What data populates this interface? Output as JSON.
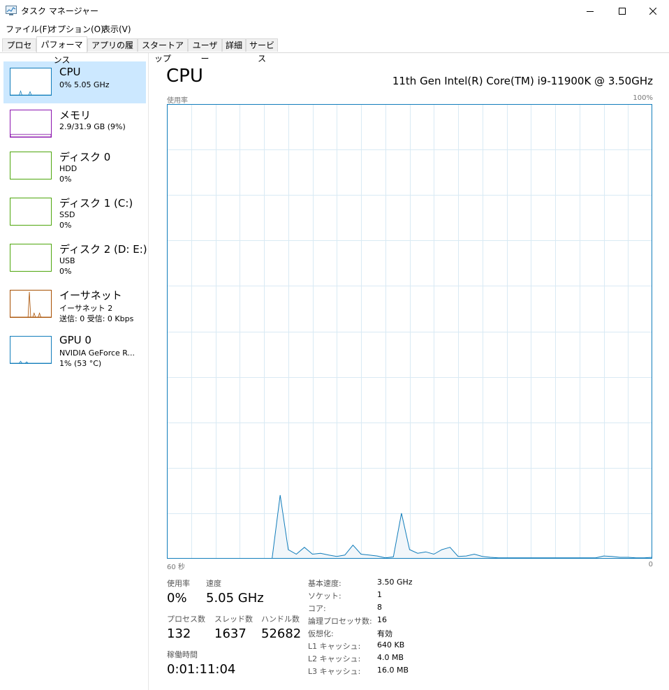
{
  "window": {
    "title": "タスク マネージャー"
  },
  "menu": [
    "ファイル(F)",
    "オプション(O)",
    "表示(V)"
  ],
  "tabs": [
    "プロセス",
    "パフォーマンス",
    "アプリの履歴",
    "スタートアップ",
    "ユーザー",
    "詳細",
    "サービス"
  ],
  "active_tab": "パフォーマンス",
  "sidebar": {
    "items": [
      {
        "title": "CPU",
        "line1": "0%  5.05 GHz",
        "line2": "",
        "color": "#117dbb"
      },
      {
        "title": "メモリ",
        "line1": "2.9/31.9 GB (9%)",
        "line2": "",
        "color": "#8b12ae"
      },
      {
        "title": "ディスク 0",
        "line1": "HDD",
        "line2": "0%",
        "color": "#4da60c"
      },
      {
        "title": "ディスク 1 (C:)",
        "line1": "SSD",
        "line2": "0%",
        "color": "#4da60c"
      },
      {
        "title": "ディスク 2 (D: E:)",
        "line1": "USB",
        "line2": "0%",
        "color": "#4da60c"
      },
      {
        "title": "イーサネット",
        "line1": "イーサネット 2",
        "line2": "送信: 0 受信: 0 Kbps",
        "color": "#a74f01"
      },
      {
        "title": "GPU 0",
        "line1": "NVIDIA GeForce R...",
        "line2": "1% (53 °C)",
        "color": "#117dbb"
      }
    ]
  },
  "main": {
    "title": "CPU",
    "processor": "11th Gen Intel(R) Core(TM) i9-11900K @ 3.50GHz",
    "graph_label_left": "使用率",
    "graph_label_right": "100%",
    "axis_left": "60 秒",
    "axis_right": "0"
  },
  "chart_data": {
    "type": "area",
    "x": [
      60,
      59,
      58,
      57,
      56,
      55,
      54,
      53,
      52,
      51,
      50,
      49,
      48,
      47,
      46,
      45,
      44,
      43,
      42,
      41,
      40,
      39,
      38,
      37,
      36,
      35,
      34,
      33,
      32,
      31,
      30,
      29,
      28,
      27,
      26,
      25,
      24,
      23,
      22,
      21,
      20,
      19,
      18,
      17,
      16,
      15,
      14,
      13,
      12,
      11,
      10,
      9,
      8,
      7,
      6,
      5,
      4,
      3,
      2,
      1,
      0
    ],
    "values": [
      0,
      0,
      0,
      0,
      0,
      0,
      0,
      0,
      0,
      0,
      0,
      0,
      0,
      0,
      14,
      2,
      1,
      2.5,
      1,
      1.2,
      0.8,
      0.5,
      0.8,
      3,
      1,
      0.8,
      0.6,
      0.2,
      0.4,
      10,
      2,
      1.2,
      1.5,
      1,
      2,
      2.5,
      0.5,
      0.6,
      1,
      0.5,
      0.3,
      0.2,
      0.2,
      0.2,
      0.2,
      0.2,
      0.2,
      0.2,
      0.2,
      0.2,
      0.2,
      0.2,
      0.2,
      0.2,
      0.6,
      0.5,
      0.3,
      0.3,
      0.2,
      0.2,
      0.3
    ],
    "ylim": [
      0,
      100
    ],
    "xlim": [
      60,
      0
    ],
    "grid": true,
    "line_color": "#117dbb",
    "fill_color": "#f1f6fa",
    "grid_color": "#d9eaf4"
  },
  "stats": {
    "usage_label": "使用率",
    "usage_value": "0%",
    "speed_label": "速度",
    "speed_value": "5.05 GHz",
    "processes_label": "プロセス数",
    "processes_value": "132",
    "threads_label": "スレッド数",
    "threads_value": "1637",
    "handles_label": "ハンドル数",
    "handles_value": "52682",
    "uptime_label": "稼働時間",
    "uptime_value": "0:01:11:04"
  },
  "details": [
    {
      "label": "基本速度:",
      "value": "3.50 GHz"
    },
    {
      "label": "ソケット:",
      "value": "1"
    },
    {
      "label": "コア:",
      "value": "8"
    },
    {
      "label": "論理プロセッサ数:",
      "value": "16"
    },
    {
      "label": "仮想化:",
      "value": "有効"
    },
    {
      "label": "L1 キャッシュ:",
      "value": "640 KB"
    },
    {
      "label": "L2 キャッシュ:",
      "value": "4.0 MB"
    },
    {
      "label": "L3 キャッシュ:",
      "value": "16.0 MB"
    }
  ]
}
